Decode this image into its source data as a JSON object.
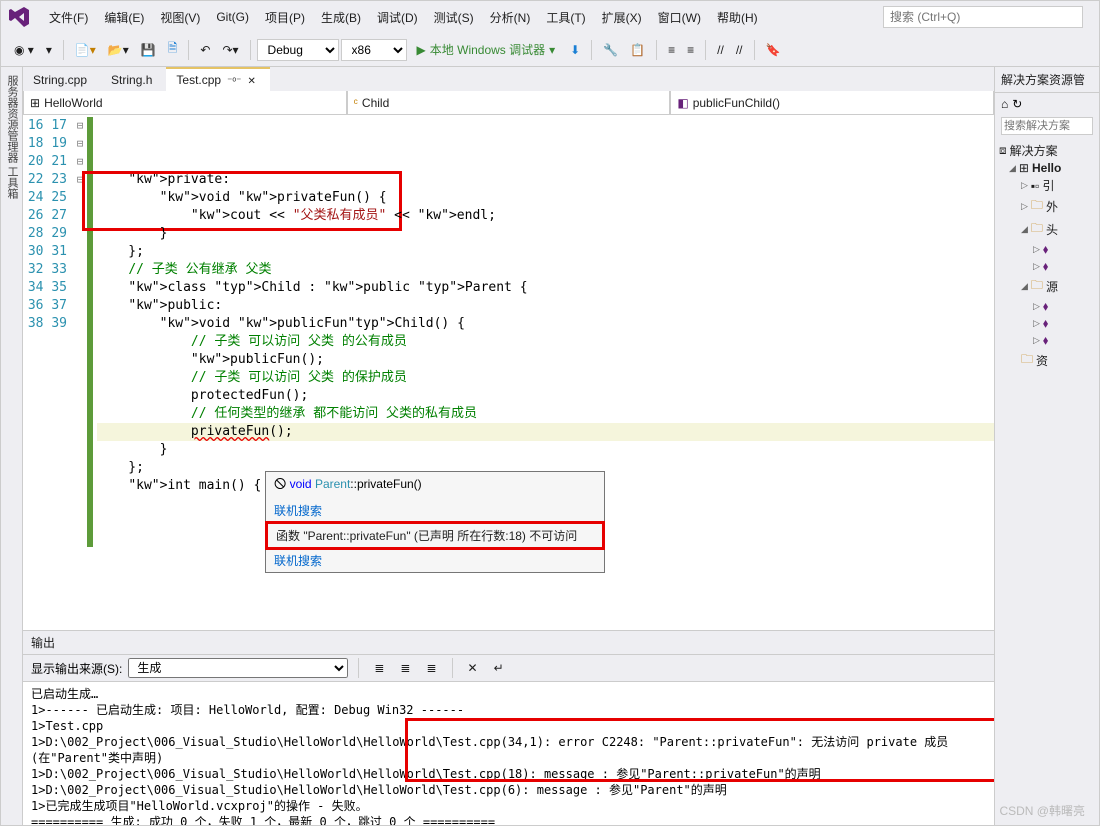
{
  "menu": {
    "items": [
      "文件(F)",
      "编辑(E)",
      "视图(V)",
      "Git(G)",
      "项目(P)",
      "生成(B)",
      "调试(D)",
      "测试(S)",
      "分析(N)",
      "工具(T)",
      "扩展(X)",
      "窗口(W)",
      "帮助(H)"
    ],
    "search_placeholder": "搜索 (Ctrl+Q)"
  },
  "toolbar": {
    "config": "Debug",
    "platform": "x86",
    "start_label": "本地 Windows 调试器"
  },
  "tabs": [
    "String.cpp",
    "String.h",
    "Test.cpp"
  ],
  "active_tab": "Test.cpp",
  "nav": {
    "scope1": "HelloWorld",
    "scope2": "Child",
    "scope3": "publicFunChild()"
  },
  "line_start": 16,
  "code_lines": [
    "",
    "    private:",
    "        void privateFun() {",
    "            cout << \"父类私有成员\" << endl;",
    "        }",
    "    };",
    "",
    "    // 子类 公有继承 父类",
    "    class Child : public Parent {",
    "    public:",
    "        void publicFunChild() {",
    "            // 子类 可以访问 父类 的公有成员",
    "            publicFun();",
    "",
    "            // 子类 可以访问 父类 的保护成员",
    "            protectedFun();",
    "",
    "            // 任何类型的继承 都不能访问 父类的私有成员",
    "            privateFun();",
    "        }",
    "    };",
    "",
    "    int main() {",
    ""
  ],
  "tooltip": {
    "signature_void": "void",
    "signature_class": "Parent",
    "signature_fn": "privateFun",
    "link1": "联机搜索",
    "error_text": "函数 \"Parent::privateFun\" (已声明 所在行数:18) 不可访问",
    "link2": "联机搜索"
  },
  "output": {
    "title": "输出",
    "source_label": "显示输出来源(S):",
    "source_value": "生成",
    "lines": [
      "已启动生成…",
      "1>------ 已启动生成: 项目: HelloWorld, 配置: Debug Win32 ------",
      "1>Test.cpp",
      "1>D:\\002_Project\\006_Visual_Studio\\HelloWorld\\HelloWorld\\Test.cpp(34,1): error C2248: \"Parent::privateFun\": 无法访问 private 成员(在\"Parent\"类中声明)",
      "1>D:\\002_Project\\006_Visual_Studio\\HelloWorld\\HelloWorld\\Test.cpp(18): message : 参见\"Parent::privateFun\"的声明",
      "1>D:\\002_Project\\006_Visual_Studio\\HelloWorld\\HelloWorld\\Test.cpp(6): message : 参见\"Parent\"的声明",
      "1>已完成生成项目\"HelloWorld.vcxproj\"的操作 - 失败。",
      "========== 生成: 成功 0 个，失败 1 个，最新 0 个，跳过 0 个 =========="
    ]
  },
  "solution": {
    "title": "解决方案资源管",
    "search_placeholder": "搜索解决方案",
    "root": "解决方案",
    "project": "Hello",
    "nodes": [
      "引",
      "外",
      "头",
      "源",
      "资"
    ]
  },
  "side_tabs": "服务器资源管理器  工具箱",
  "watermark": "CSDN @韩曙亮"
}
